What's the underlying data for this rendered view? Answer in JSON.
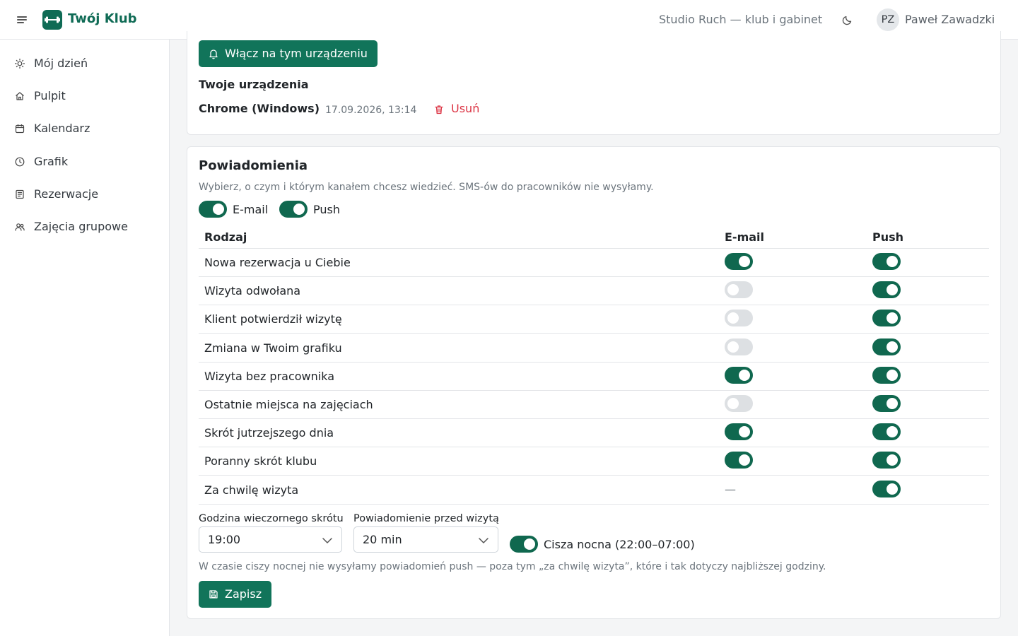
{
  "header": {
    "brand": "Twój Klub",
    "studio": "Studio Ruch — klub i gabinet",
    "avatar_initials": "PZ",
    "user_name": "Paweł Zawadzki",
    "accent_color": "#0f6b55"
  },
  "sidebar": {
    "items": [
      {
        "label": "Mój dzień",
        "icon": "sun-icon"
      },
      {
        "label": "Pulpit",
        "icon": "home-icon"
      },
      {
        "label": "Kalendarz",
        "icon": "calendar-icon"
      },
      {
        "label": "Grafik",
        "icon": "clock-icon"
      },
      {
        "label": "Rezerwacje",
        "icon": "list-icon"
      },
      {
        "label": "Zajęcia grupowe",
        "icon": "users-icon"
      }
    ]
  },
  "push_card": {
    "enable_button": "Włącz na tym urządzeniu",
    "devices_heading": "Twoje urządzenia",
    "device": {
      "name": "Chrome (Windows)",
      "date": "17.09.2026, 13:14"
    },
    "delete_label": "Usuń"
  },
  "notifications": {
    "title": "Powiadomienia",
    "description": "Wybierz, o czym i którym kanałem chcesz wiedzieć. SMS-ów do pracowników nie wysyłamy.",
    "master": {
      "email": {
        "label": "E-mail",
        "on": true
      },
      "push": {
        "label": "Push",
        "on": true
      }
    },
    "columns": {
      "type": "Rodzaj",
      "email": "E-mail",
      "push": "Push"
    },
    "rows": [
      {
        "label": "Nowa rezerwacja u Ciebie",
        "email": true,
        "push": true
      },
      {
        "label": "Wizyta odwołana",
        "email": false,
        "push": true
      },
      {
        "label": "Klient potwierdził wizytę",
        "email": false,
        "push": true
      },
      {
        "label": "Zmiana w Twoim grafiku",
        "email": false,
        "push": true
      },
      {
        "label": "Wizyta bez pracownika",
        "email": true,
        "push": true
      },
      {
        "label": "Ostatnie miejsca na zajęciach",
        "email": false,
        "push": true
      },
      {
        "label": "Skrót jutrzejszego dnia",
        "email": true,
        "push": true
      },
      {
        "label": "Poranny skrót klubu",
        "email": true,
        "push": true
      },
      {
        "label": "Za chwilę wizyta",
        "email": null,
        "email_text": "—",
        "push": true
      }
    ],
    "evening_label": "Godzina wieczornego skrótu",
    "evening_value": "19:00",
    "before_label": "Powiadomienie przed wizytą",
    "before_value": "20 min",
    "quiet": {
      "label": "Cisza nocna (22:00–07:00)",
      "on": true
    },
    "hint": "W czasie ciszy nocnej nie wysyłamy powiadomień push — poza tym „za chwilę wizyta”, które i tak dotyczy najbliższej godziny.",
    "save_label": "Zapisz"
  }
}
